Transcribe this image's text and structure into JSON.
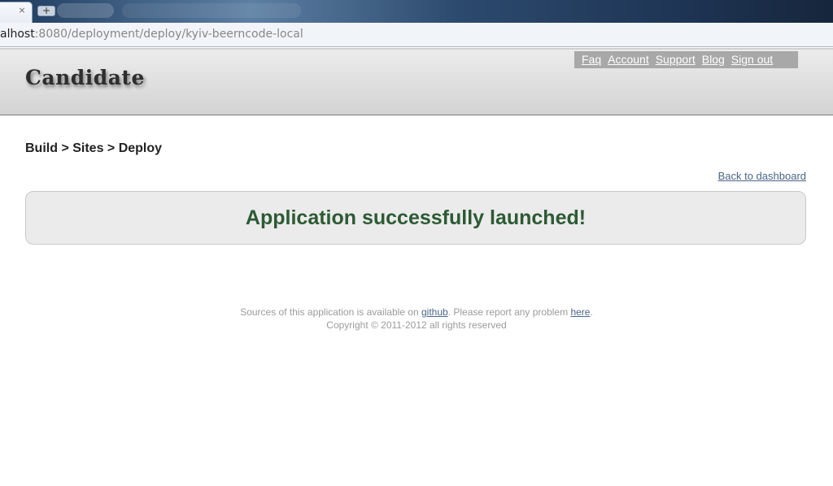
{
  "browser": {
    "tab_close_glyph": "×",
    "new_tab_glyph": "+",
    "url_host": "alhost",
    "url_path": ":8080/deployment/deploy/kyiv-beerncode-local"
  },
  "header": {
    "logo": "Candidate",
    "nav": [
      "Faq",
      "Account",
      "Support",
      "Blog",
      "Sign out"
    ]
  },
  "main": {
    "breadcrumb": "Build > Sites > Deploy",
    "back_link": "Back to dashboard",
    "message": "Application successfully launched!"
  },
  "footer": {
    "line1_prefix": "Sources of this application is available on ",
    "github_link": "github",
    "line1_middle": ". Please report any problem ",
    "here_link": "here",
    "line1_suffix": ".",
    "line2": "Copyright © 2011-2012 all rights reserved"
  },
  "colors": {
    "success_text": "#2d5a34",
    "link": "#4a6587",
    "nav_bg": "#a8a8a8"
  }
}
